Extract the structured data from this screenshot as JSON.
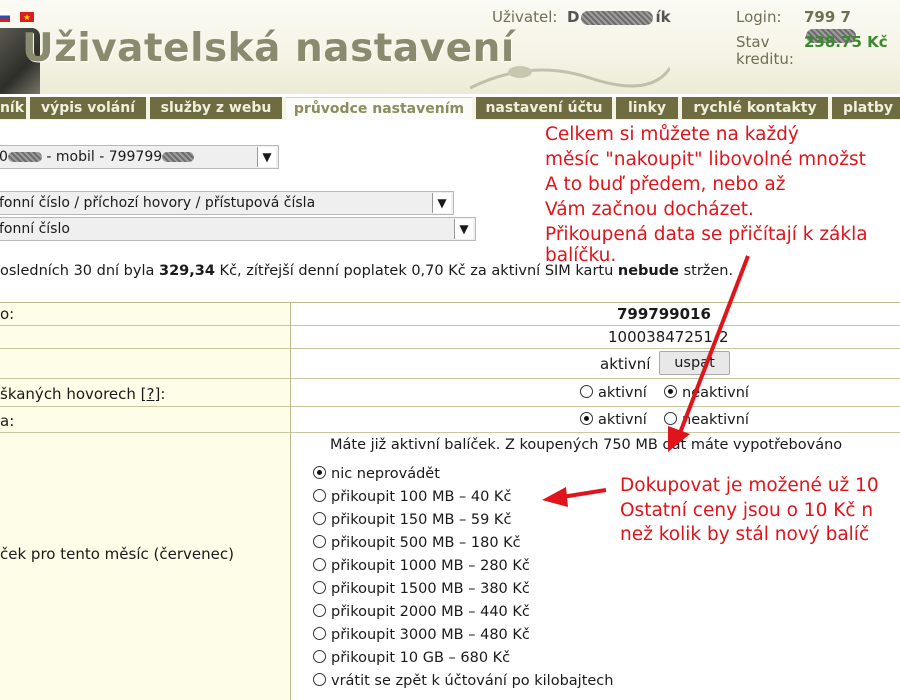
{
  "header": {
    "title": "Uživatelská nastavení",
    "user_label": "Uživatel:",
    "user_value_start": "D",
    "user_value_end": "ík",
    "login_label": "Login:",
    "login_value": "799 7",
    "credit_label_1": "Stav",
    "credit_label_2": "kreditu:",
    "credit_value": "238.75 Kč"
  },
  "tabs": [
    "ník",
    "výpis volání",
    "služby z webu",
    "průvodce nastavením",
    "nastavení účtu",
    "linky",
    "rychlé kontakty",
    "platby"
  ],
  "active_tab": 3,
  "selects": {
    "account_a": "0",
    "account_b": " - mobil - 799799",
    "category": "fonní číslo / příchozí hovory / přístupová čísla",
    "item": "fonní číslo"
  },
  "summary": {
    "part1": "osledních 30 dní byla ",
    "amount": "329,34",
    "part2": " Kč, zítřejší denní poplatek 0,70 Kč za aktivní SIM kartu ",
    "bold2": "nebude",
    "part3": " stržen."
  },
  "rows": {
    "r1_label": "o:",
    "r1_value": "799799016",
    "r2_value": "10003847251",
    "r2_value_end": "2",
    "r3_status": "aktivní",
    "r3_button": "uspat",
    "r4_label_a": "škaných hovorech [",
    "r4_label_link": "?",
    "r4_label_b": "]:",
    "r4_opt_active": "aktivní",
    "r4_opt_inactive": "neaktivní",
    "r5_label": "a:",
    "r5_opt_active": "aktivní",
    "r5_opt_inactive": "neaktivní",
    "r6_label": "ček pro tento měsíc (červenec)",
    "r6_info": "Máte již aktivní balíček. Z koupených 750 MB dat máte vypotřebováno"
  },
  "data_options": [
    "nic neprovádět",
    "přikoupit 100 MB – 40 Kč",
    "přikoupit 150 MB – 59 Kč",
    "přikoupit 500 MB – 180 Kč",
    "přikoupit 1000 MB – 280 Kč",
    "přikoupit 1500 MB – 380 Kč",
    "přikoupit 2000 MB – 440 Kč",
    "přikoupit 3000 MB – 480 Kč",
    "přikoupit 10 GB – 680 Kč",
    "vrátit se zpět k účtování po kilobajtech"
  ],
  "selected_option": 0,
  "annotations": {
    "top": [
      "Celkem si můžete na každý",
      "měsíc \"nakoupit\" libovolné množst",
      "A to buď předem, nebo až",
      "Vám začnou docházet.",
      "Přikoupená data se přičítají k zákla",
      "balíčku."
    ],
    "right": [
      "Dokupovat je možené už 10",
      "Ostatní ceny jsou o 10 Kč n",
      "než kolik by stál nový balíč"
    ]
  },
  "colors": {
    "tab_bg": "#6e6c40",
    "annotation": "#e0141b",
    "credit": "#3b8a2f",
    "label_bg": "#fefee8"
  }
}
